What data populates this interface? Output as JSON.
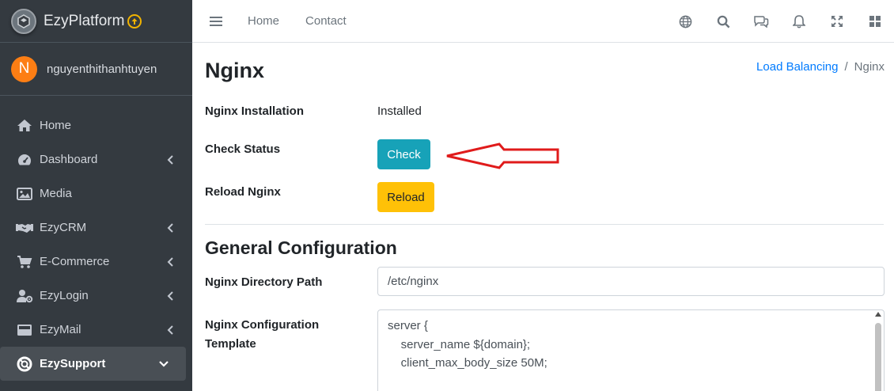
{
  "brand": {
    "name": "EzyPlatform"
  },
  "user": {
    "initial": "N",
    "name": "nguyenthithanhtuyen"
  },
  "sidebar": {
    "items": [
      {
        "label": "Home",
        "icon": "home-icon"
      },
      {
        "label": "Dashboard",
        "icon": "dashboard-icon"
      },
      {
        "label": "Media",
        "icon": "image-icon"
      },
      {
        "label": "EzyCRM",
        "icon": "handshake-icon"
      },
      {
        "label": "E-Commerce",
        "icon": "cart-icon"
      },
      {
        "label": "EzyLogin",
        "icon": "user-gear-icon"
      },
      {
        "label": "EzyMail",
        "icon": "mail-icon"
      },
      {
        "label": "EzySupport",
        "icon": "lifebuoy-icon"
      }
    ]
  },
  "topbar": {
    "links": [
      "Home",
      "Contact"
    ],
    "icons": [
      "globe-icon",
      "search-icon",
      "chat-icon",
      "bell-icon",
      "expand-icon",
      "apps-icon"
    ]
  },
  "page": {
    "title": "Nginx",
    "breadcrumb": {
      "parent": "Load Balancing",
      "separator": "/",
      "current": "Nginx"
    },
    "installation": {
      "label": "Nginx Installation",
      "value": "Installed"
    },
    "check_status": {
      "label": "Check Status",
      "button": "Check"
    },
    "reload": {
      "label": "Reload Nginx",
      "button": "Reload"
    },
    "general": {
      "title": "General Configuration",
      "directory": {
        "label": "Nginx Directory Path",
        "value": "/etc/nginx"
      },
      "template": {
        "label_line1": "Nginx Configuration",
        "label_line2": "Template",
        "lines": [
          "server {",
          "    server_name ${domain};",
          "    client_max_body_size 50M;"
        ]
      }
    }
  },
  "colors": {
    "sidebar_bg": "#343a40",
    "check_button": "#17a2b8",
    "reload_button": "#ffc107",
    "link": "#007bff",
    "annotation_arrow": "#e01b1b",
    "avatar": "#fd7e14"
  }
}
